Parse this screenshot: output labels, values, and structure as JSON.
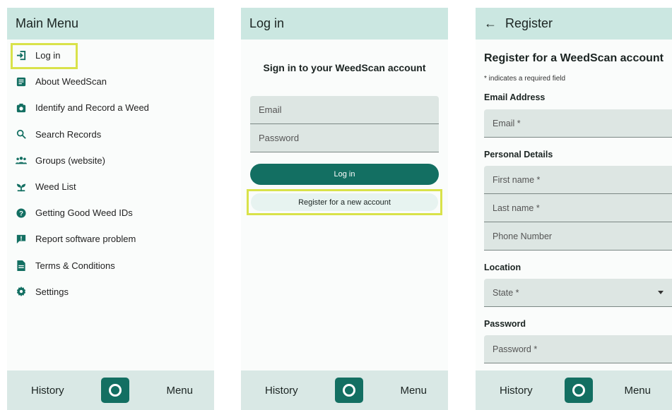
{
  "screens": {
    "menu": {
      "title": "Main Menu",
      "items": [
        {
          "label": "Log in",
          "icon": "login-icon"
        },
        {
          "label": "About WeedScan",
          "icon": "document-icon"
        },
        {
          "label": "Identify and Record a Weed",
          "icon": "camera-icon"
        },
        {
          "label": "Search Records",
          "icon": "search-icon"
        },
        {
          "label": "Groups (website)",
          "icon": "group-icon"
        },
        {
          "label": "Weed List",
          "icon": "sprout-icon"
        },
        {
          "label": "Getting Good Weed IDs",
          "icon": "help-icon"
        },
        {
          "label": "Report software problem",
          "icon": "feedback-icon"
        },
        {
          "label": "Terms & Conditions",
          "icon": "file-icon"
        },
        {
          "label": "Settings",
          "icon": "gear-icon"
        }
      ]
    },
    "login": {
      "title": "Log in",
      "heading": "Sign in to your WeedScan account",
      "email_placeholder": "Email",
      "password_placeholder": "Password",
      "login_button": "Log in",
      "register_button": "Register for a new account"
    },
    "register": {
      "title": "Register",
      "heading": "Register for a WeedScan account",
      "note": "* indicates a required field",
      "sections": {
        "email": "Email Address",
        "personal": "Personal Details",
        "location": "Location",
        "password": "Password"
      },
      "fields": {
        "email": "Email *",
        "first_name": "First name *",
        "last_name": "Last name *",
        "phone": "Phone Number",
        "state": "State *",
        "password": "Password *"
      }
    }
  },
  "bottom_nav": {
    "history": "History",
    "menu": "Menu"
  },
  "colors": {
    "accent": "#136f62",
    "appbar": "#cbe7e1",
    "highlight": "#d9e24a"
  }
}
